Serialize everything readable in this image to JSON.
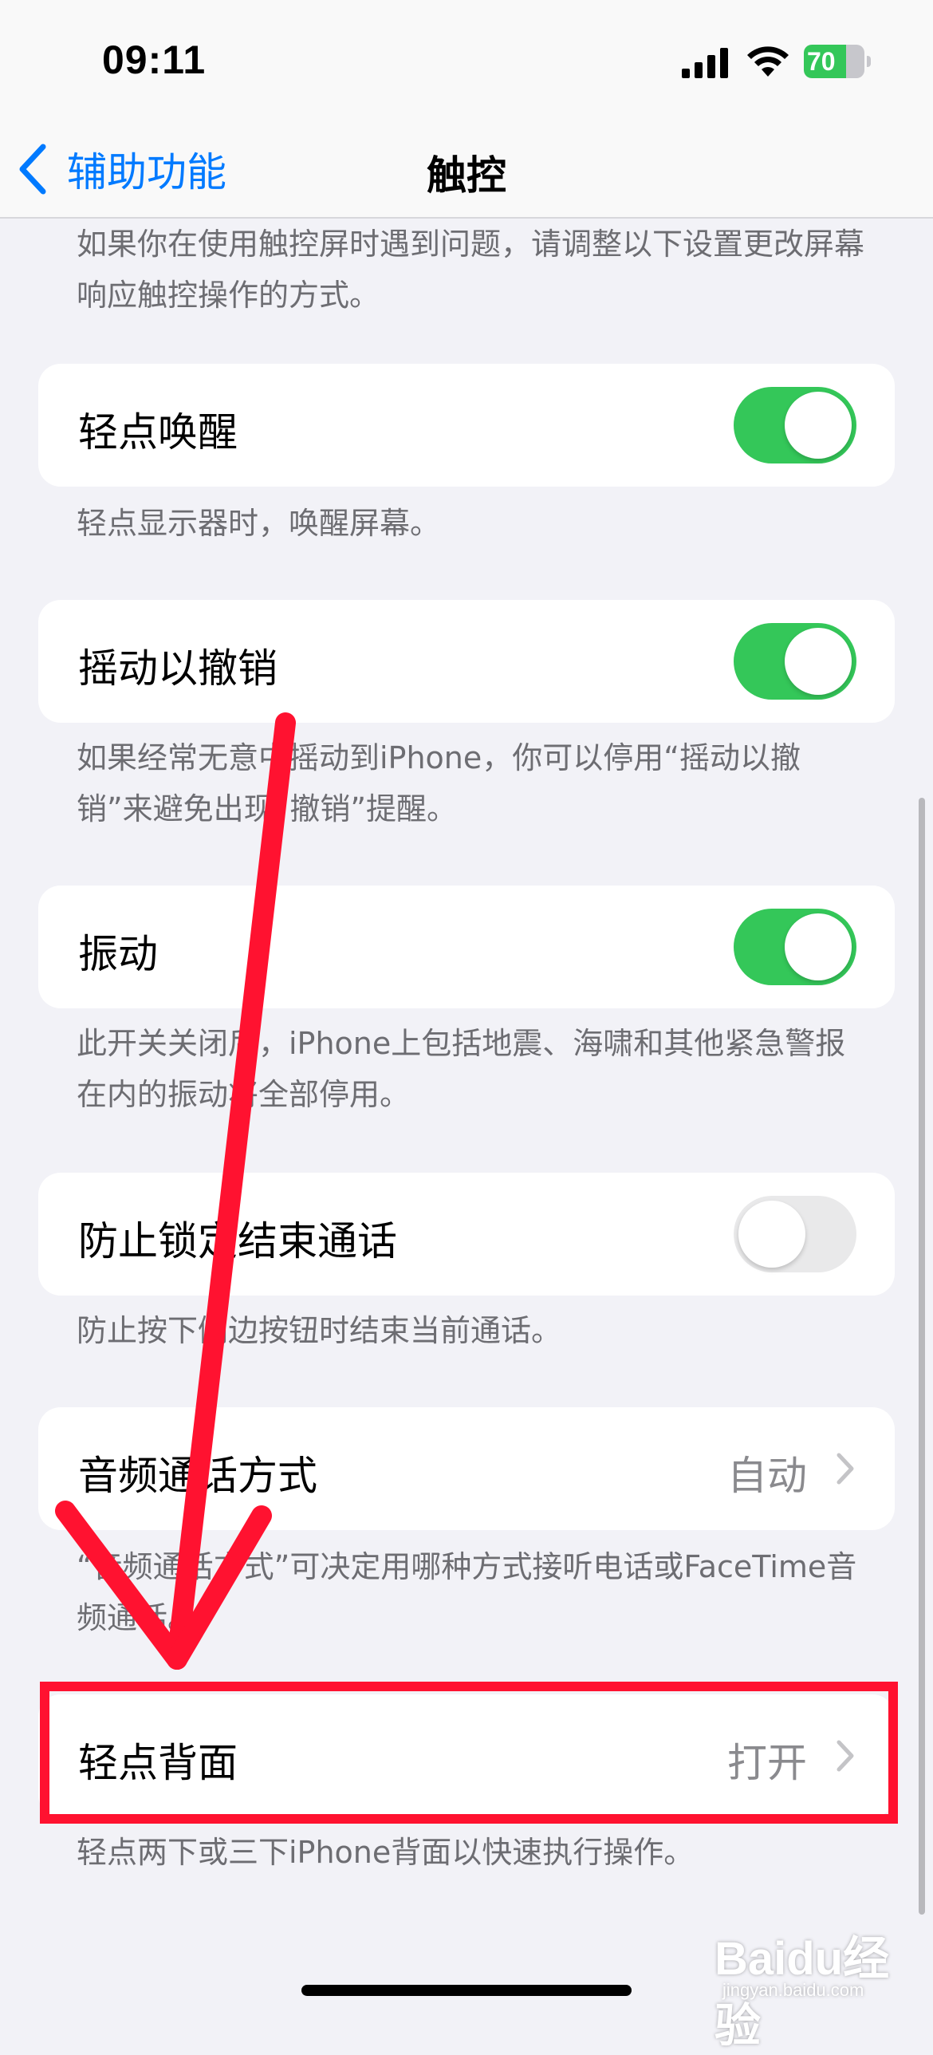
{
  "status_bar": {
    "time": "09:11",
    "battery_level": "70",
    "battery_fraction": 0.7
  },
  "nav": {
    "back_label": "辅助功能",
    "title": "触控"
  },
  "intro_text": "如果你在使用触控屏时遇到问题，请调整以下设置更改屏幕响应触控操作的方式。",
  "settings": [
    {
      "label": "轻点唤醒",
      "control": "toggle",
      "on": true,
      "footer": "轻点显示器时，唤醒屏幕。"
    },
    {
      "label": "摇动以撤销",
      "control": "toggle",
      "on": true,
      "footer": "如果经常无意中摇动到iPhone，你可以停用“摇动以撤销”来避免出现“撤销”提醒。"
    },
    {
      "label": "振动",
      "control": "toggle",
      "on": true,
      "footer": "此开关关闭后，iPhone上包括地震、海啸和其他紧急警报在内的振动将全部停用。"
    },
    {
      "label": "防止锁定结束通话",
      "control": "toggle",
      "on": false,
      "footer": "防止按下侧边按钮时结束当前通话。"
    },
    {
      "label": "音频通话方式",
      "control": "disclosure",
      "value": "自动",
      "footer": "“音频通话方式”可决定用哪种方式接听电话或FaceTime音频通话。"
    },
    {
      "label": "轻点背面",
      "control": "disclosure",
      "value": "打开",
      "footer": "轻点两下或三下iPhone背面以快速执行操作。"
    }
  ],
  "watermark": {
    "logo": "Baidu经验",
    "sub": "jingyan.baidu.com"
  },
  "colors": {
    "accent": "#007aff",
    "toggle_on": "#34c759",
    "toggle_off": "#e9e9ea",
    "annotation": "#ff1230",
    "background": "#f2f2f7"
  }
}
